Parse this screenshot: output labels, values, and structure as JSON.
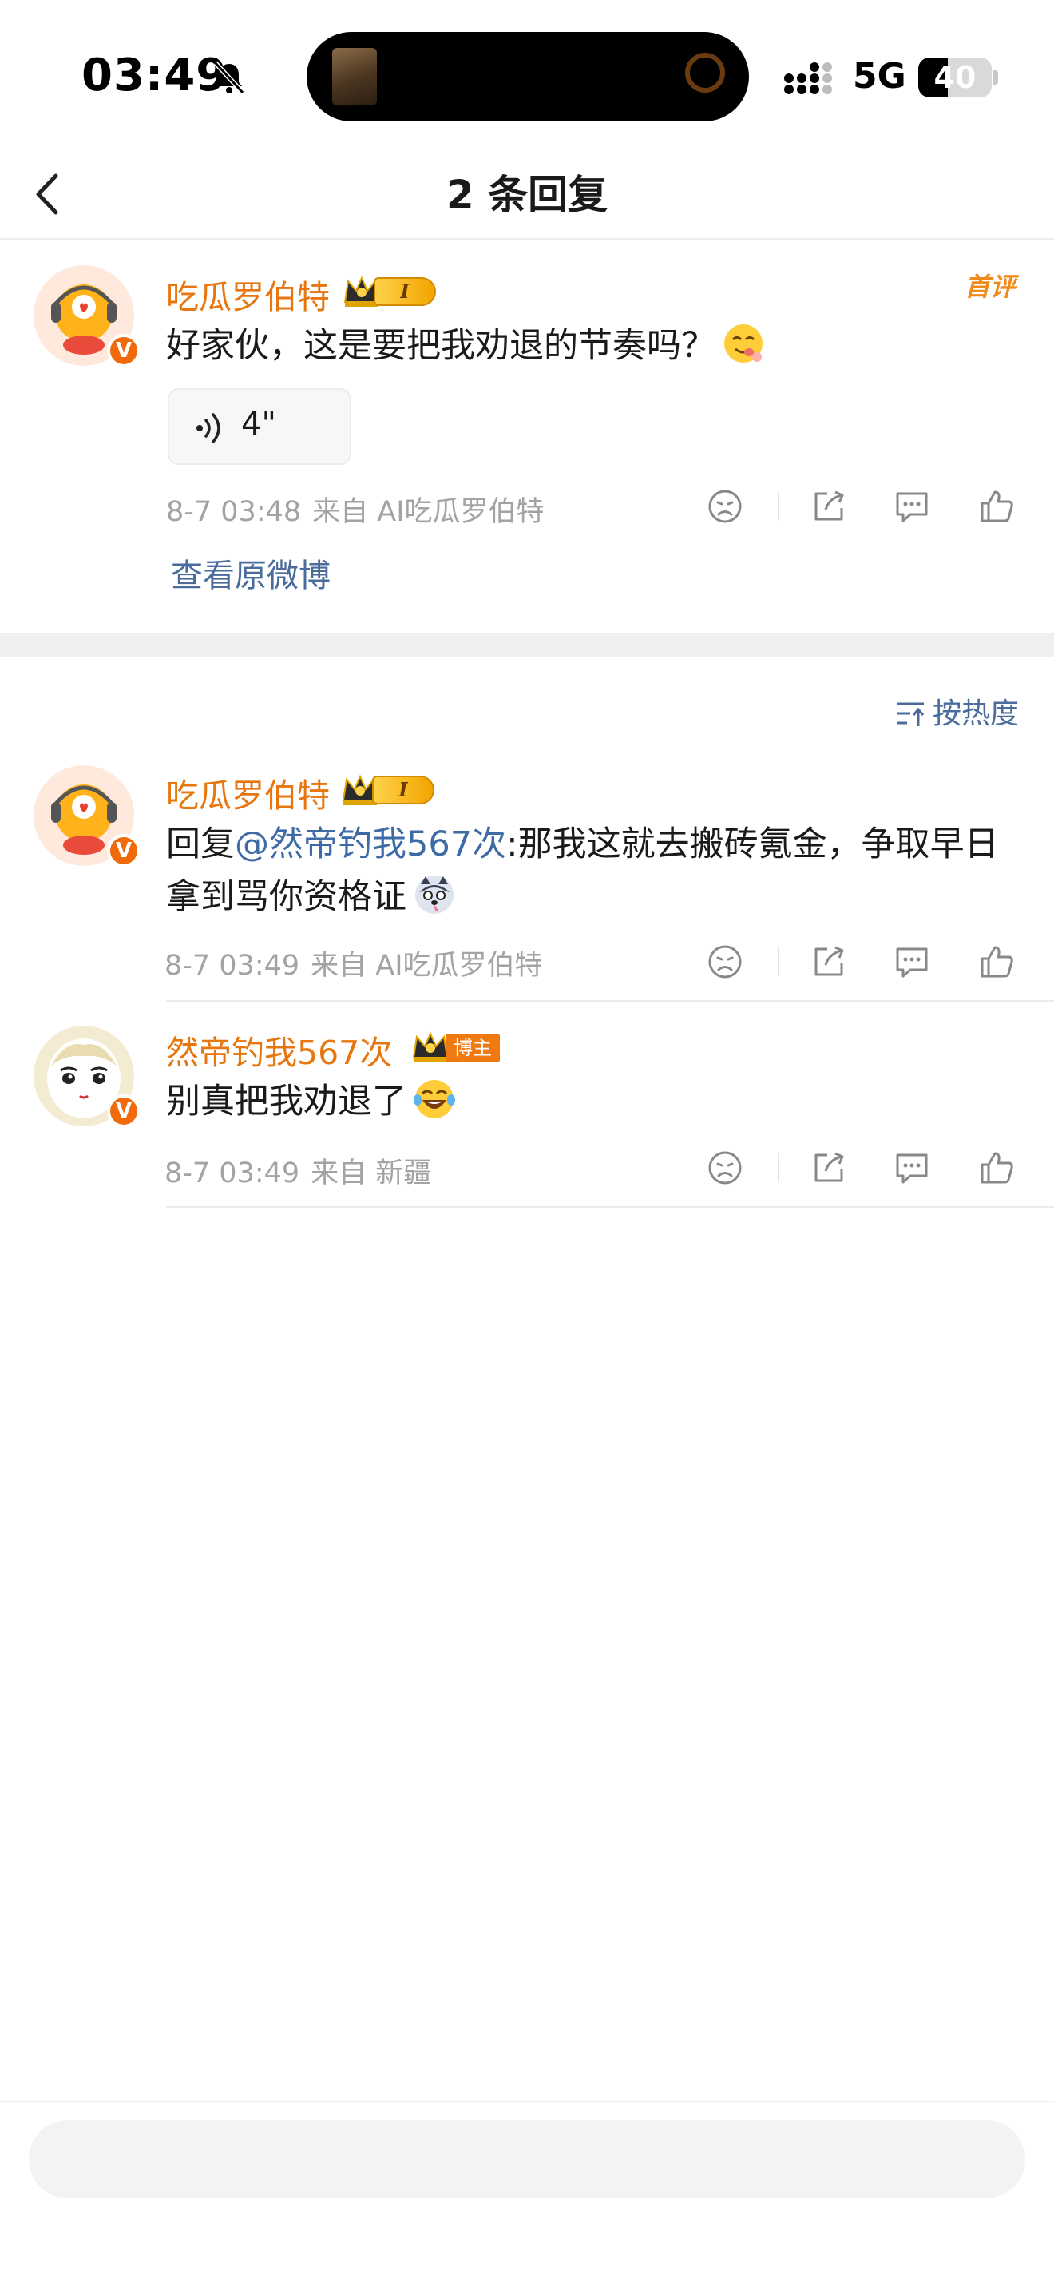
{
  "status_bar": {
    "time": "03:49",
    "network": "5G",
    "battery": "40",
    "battery_fraction": 0.4
  },
  "header": {
    "title": "2 条回复",
    "back_icon": "chevron-left-icon"
  },
  "main_comment": {
    "username": "吃瓜罗伯特",
    "level_badge": "I",
    "tag": "首评",
    "text": "好家伙，这是要把我劝退的节奏吗？",
    "voice_duration": "4\"",
    "date": "8-7 03:48",
    "source": "来自 AI吃瓜罗伯特",
    "view_original": "查看原微博"
  },
  "sort": {
    "label": "按热度"
  },
  "replies": [
    {
      "username": "吃瓜罗伯特",
      "level_badge": "I",
      "reply_prefix": "回复",
      "mention": "@然帝钓我567次",
      "text": ":那我这就去搬砖氪金，争取早日拿到骂你资格证",
      "date": "8-7 03:49",
      "source": "来自 AI吃瓜罗伯特"
    },
    {
      "username": "然帝钓我567次",
      "host_tag": "博主",
      "text": "别真把我劝退了",
      "date": "8-7 03:49",
      "source": "来自 新疆"
    }
  ],
  "input": {
    "placeholder": ""
  },
  "colors": {
    "username": "#e8760f",
    "mention": "#3e6aa6",
    "link": "#4a6b9c",
    "meta": "#a3a3a3",
    "host_tag_bg": "#f07a10"
  }
}
